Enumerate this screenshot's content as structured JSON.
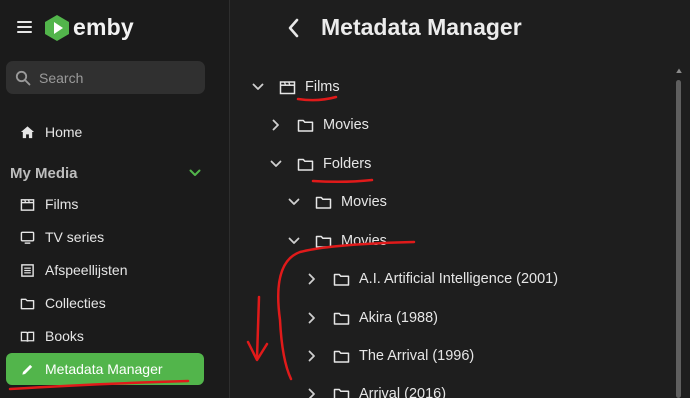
{
  "app": {
    "name": "emby"
  },
  "search": {
    "placeholder": "Search"
  },
  "nav": {
    "home": "Home",
    "section": "My Media",
    "items": [
      {
        "label": "Films",
        "icon": "film-icon"
      },
      {
        "label": "TV series",
        "icon": "tv-icon"
      },
      {
        "label": "Afspeellijsten",
        "icon": "playlist-icon"
      },
      {
        "label": "Collecties",
        "icon": "folder-icon"
      },
      {
        "label": "Books",
        "icon": "book-icon"
      },
      {
        "label": "Metadata Manager",
        "icon": "pencil-icon",
        "active": true
      }
    ]
  },
  "main": {
    "title": "Metadata Manager",
    "tree": [
      {
        "label": "Films",
        "expanded": true,
        "icon": "film-icon"
      },
      {
        "label": "Movies",
        "expanded": false,
        "icon": "folder-icon"
      },
      {
        "label": "Folders",
        "expanded": true,
        "icon": "folder-icon"
      },
      {
        "label": "Movies",
        "expanded": true,
        "icon": "folder-icon"
      },
      {
        "label": "Movies",
        "expanded": true,
        "icon": "folder-icon"
      },
      {
        "label": "A.I. Artificial Intelligence (2001)",
        "expanded": false,
        "icon": "folder-icon"
      },
      {
        "label": "Akira (1988)",
        "expanded": false,
        "icon": "folder-icon"
      },
      {
        "label": "The Arrival (1996)",
        "expanded": false,
        "icon": "folder-icon"
      },
      {
        "label": "Arrival (2016)",
        "expanded": false,
        "icon": "folder-icon"
      }
    ]
  },
  "colors": {
    "accent": "#52b54b",
    "annotation": "#e01a1a",
    "background": "#1e1e1e",
    "sidebar": "#1b1b1b"
  }
}
